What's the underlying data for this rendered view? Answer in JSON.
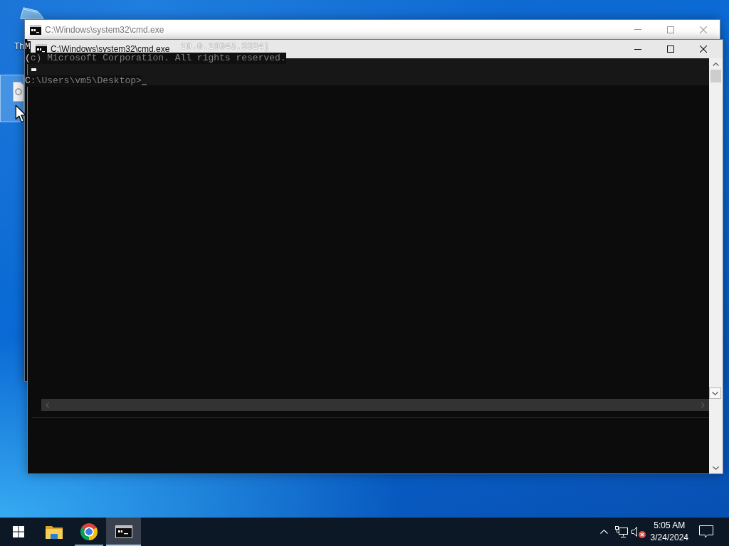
{
  "desktop": {
    "icons": [
      {
        "kind": "bin",
        "label": "Th",
        "selected": false
      },
      {
        "kind": "document",
        "selected": true
      }
    ]
  },
  "windows": [
    {
      "title": "C:\\Windows\\system32\\cmd.exe",
      "active": false,
      "console_lines": [
        {
          "segments": [
            {
              "text": "M",
              "faint": false
            },
            {
              "text": "10.0.19045.3324]",
              "faint": true
            }
          ]
        },
        {
          "segments": [
            {
              "text": "(",
              "faint": false
            },
            {
              "text": "c) Microsoft Corporation. All rights reserved.",
              "faint": true
            }
          ]
        },
        {
          "segments": [
            {
              "text": "C",
              "faint": false
            },
            {
              "text": ":\\Users\\vm5\\Desktop>",
              "faint": true
            }
          ]
        }
      ]
    },
    {
      "title": "C:\\Windows\\system32\\cmd.exe",
      "active": true
    }
  ],
  "taskbar": {
    "apps": [
      {
        "kind": "folder",
        "running": false,
        "active": false
      },
      {
        "kind": "browser",
        "running": true,
        "active": false
      },
      {
        "kind": "console",
        "running": true,
        "active": true
      }
    ],
    "tray": {
      "volume_muted": true,
      "time": "5:05 AM",
      "date": "3/24/2024"
    }
  }
}
